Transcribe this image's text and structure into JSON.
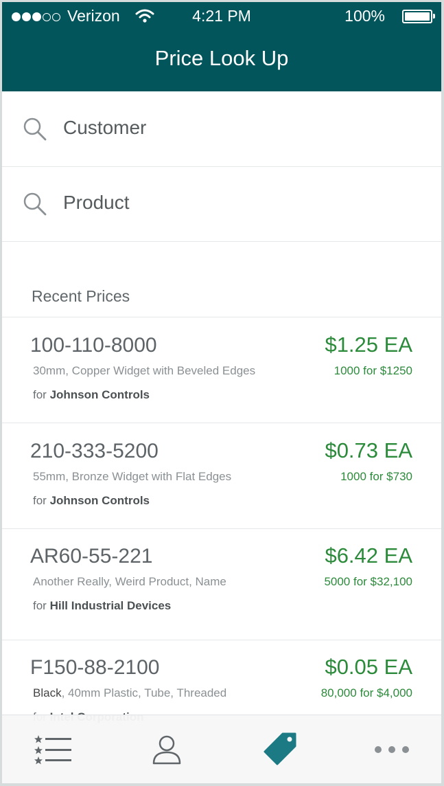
{
  "status_bar": {
    "carrier": "Verizon",
    "time": "4:21 PM",
    "battery": "100%"
  },
  "header": {
    "title": "Price Look Up"
  },
  "search": {
    "customer_placeholder": "Customer",
    "product_placeholder": "Product"
  },
  "recent": {
    "label": "Recent Prices",
    "items": [
      {
        "sku": "100-110-8000",
        "desc": "30mm, Copper Widget with Beveled Edges",
        "for_prefix": "for",
        "customer": "Johnson Controls",
        "price": "$1.25 EA",
        "qty": "1000 for $1250"
      },
      {
        "sku": "210-333-5200",
        "desc": "55mm, Bronze Widget with Flat Edges",
        "for_prefix": "for",
        "customer": "Johnson Controls",
        "price": "$0.73 EA",
        "qty": "1000 for $730"
      },
      {
        "sku": "AR60-55-221",
        "desc": "Another Really, Weird Product, Name",
        "for_prefix": "for",
        "customer": "Hill Industrial Devices",
        "price": "$6.42 EA",
        "qty": "5000 for $32,100"
      },
      {
        "sku": "F150-88-2100",
        "desc_strong": "Black",
        "desc": ", 40mm Plastic, Tube, Threaded",
        "for_prefix": "for",
        "customer": "Intel Corporation",
        "price": "$0.05 EA",
        "qty": "80,000 for $4,000"
      }
    ]
  },
  "tabbar": {
    "tabs": [
      "list-icon",
      "person-icon",
      "price-tag-icon",
      "more-icon"
    ],
    "active": "price-tag-icon",
    "active_color": "#1b7a84"
  },
  "colors": {
    "header": "#02555a",
    "price": "#2c8a3b"
  }
}
